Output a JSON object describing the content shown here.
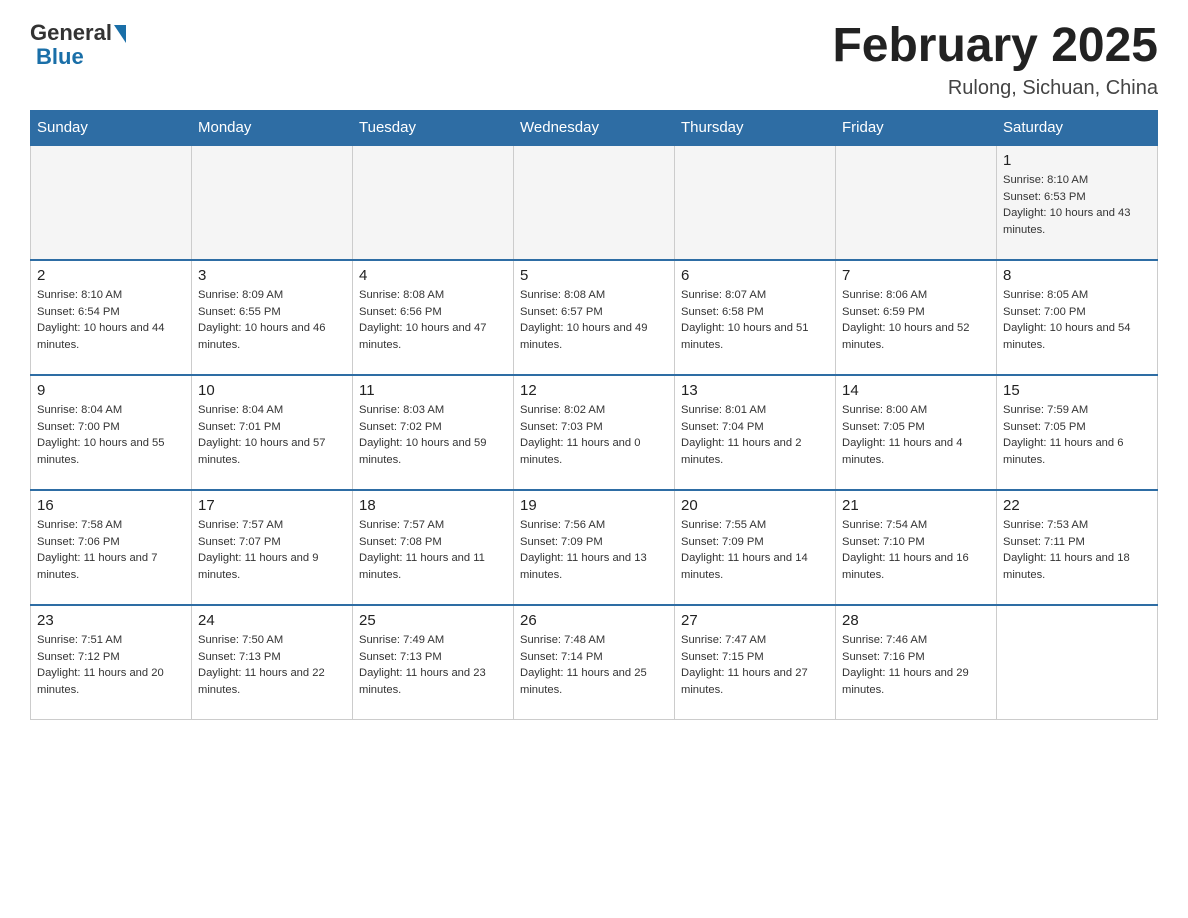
{
  "logo": {
    "general": "General",
    "blue": "Blue"
  },
  "header": {
    "title": "February 2025",
    "subtitle": "Rulong, Sichuan, China"
  },
  "days_of_week": [
    "Sunday",
    "Monday",
    "Tuesday",
    "Wednesday",
    "Thursday",
    "Friday",
    "Saturday"
  ],
  "weeks": [
    [
      {
        "day": "",
        "info": ""
      },
      {
        "day": "",
        "info": ""
      },
      {
        "day": "",
        "info": ""
      },
      {
        "day": "",
        "info": ""
      },
      {
        "day": "",
        "info": ""
      },
      {
        "day": "",
        "info": ""
      },
      {
        "day": "1",
        "info": "Sunrise: 8:10 AM\nSunset: 6:53 PM\nDaylight: 10 hours and 43 minutes."
      }
    ],
    [
      {
        "day": "2",
        "info": "Sunrise: 8:10 AM\nSunset: 6:54 PM\nDaylight: 10 hours and 44 minutes."
      },
      {
        "day": "3",
        "info": "Sunrise: 8:09 AM\nSunset: 6:55 PM\nDaylight: 10 hours and 46 minutes."
      },
      {
        "day": "4",
        "info": "Sunrise: 8:08 AM\nSunset: 6:56 PM\nDaylight: 10 hours and 47 minutes."
      },
      {
        "day": "5",
        "info": "Sunrise: 8:08 AM\nSunset: 6:57 PM\nDaylight: 10 hours and 49 minutes."
      },
      {
        "day": "6",
        "info": "Sunrise: 8:07 AM\nSunset: 6:58 PM\nDaylight: 10 hours and 51 minutes."
      },
      {
        "day": "7",
        "info": "Sunrise: 8:06 AM\nSunset: 6:59 PM\nDaylight: 10 hours and 52 minutes."
      },
      {
        "day": "8",
        "info": "Sunrise: 8:05 AM\nSunset: 7:00 PM\nDaylight: 10 hours and 54 minutes."
      }
    ],
    [
      {
        "day": "9",
        "info": "Sunrise: 8:04 AM\nSunset: 7:00 PM\nDaylight: 10 hours and 55 minutes."
      },
      {
        "day": "10",
        "info": "Sunrise: 8:04 AM\nSunset: 7:01 PM\nDaylight: 10 hours and 57 minutes."
      },
      {
        "day": "11",
        "info": "Sunrise: 8:03 AM\nSunset: 7:02 PM\nDaylight: 10 hours and 59 minutes."
      },
      {
        "day": "12",
        "info": "Sunrise: 8:02 AM\nSunset: 7:03 PM\nDaylight: 11 hours and 0 minutes."
      },
      {
        "day": "13",
        "info": "Sunrise: 8:01 AM\nSunset: 7:04 PM\nDaylight: 11 hours and 2 minutes."
      },
      {
        "day": "14",
        "info": "Sunrise: 8:00 AM\nSunset: 7:05 PM\nDaylight: 11 hours and 4 minutes."
      },
      {
        "day": "15",
        "info": "Sunrise: 7:59 AM\nSunset: 7:05 PM\nDaylight: 11 hours and 6 minutes."
      }
    ],
    [
      {
        "day": "16",
        "info": "Sunrise: 7:58 AM\nSunset: 7:06 PM\nDaylight: 11 hours and 7 minutes."
      },
      {
        "day": "17",
        "info": "Sunrise: 7:57 AM\nSunset: 7:07 PM\nDaylight: 11 hours and 9 minutes."
      },
      {
        "day": "18",
        "info": "Sunrise: 7:57 AM\nSunset: 7:08 PM\nDaylight: 11 hours and 11 minutes."
      },
      {
        "day": "19",
        "info": "Sunrise: 7:56 AM\nSunset: 7:09 PM\nDaylight: 11 hours and 13 minutes."
      },
      {
        "day": "20",
        "info": "Sunrise: 7:55 AM\nSunset: 7:09 PM\nDaylight: 11 hours and 14 minutes."
      },
      {
        "day": "21",
        "info": "Sunrise: 7:54 AM\nSunset: 7:10 PM\nDaylight: 11 hours and 16 minutes."
      },
      {
        "day": "22",
        "info": "Sunrise: 7:53 AM\nSunset: 7:11 PM\nDaylight: 11 hours and 18 minutes."
      }
    ],
    [
      {
        "day": "23",
        "info": "Sunrise: 7:51 AM\nSunset: 7:12 PM\nDaylight: 11 hours and 20 minutes."
      },
      {
        "day": "24",
        "info": "Sunrise: 7:50 AM\nSunset: 7:13 PM\nDaylight: 11 hours and 22 minutes."
      },
      {
        "day": "25",
        "info": "Sunrise: 7:49 AM\nSunset: 7:13 PM\nDaylight: 11 hours and 23 minutes."
      },
      {
        "day": "26",
        "info": "Sunrise: 7:48 AM\nSunset: 7:14 PM\nDaylight: 11 hours and 25 minutes."
      },
      {
        "day": "27",
        "info": "Sunrise: 7:47 AM\nSunset: 7:15 PM\nDaylight: 11 hours and 27 minutes."
      },
      {
        "day": "28",
        "info": "Sunrise: 7:46 AM\nSunset: 7:16 PM\nDaylight: 11 hours and 29 minutes."
      },
      {
        "day": "",
        "info": ""
      }
    ]
  ]
}
